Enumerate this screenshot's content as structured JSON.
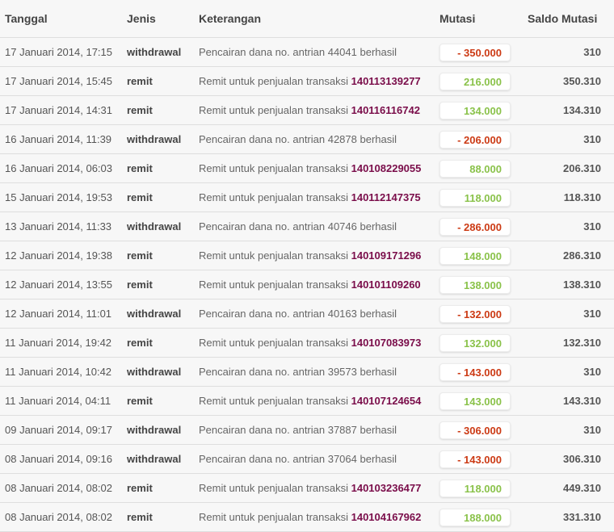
{
  "columns": {
    "date": "Tanggal",
    "type": "Jenis",
    "description": "Keterangan",
    "mutation": "Mutasi",
    "balance": "Saldo Mutasi"
  },
  "colors": {
    "negative": "#cc3a14",
    "positive": "#8ac24a",
    "transaction_id": "#7a0d4a"
  },
  "rows": [
    {
      "date": "17 Januari 2014, 17:15",
      "type": "withdrawal",
      "desc": "Pencairan dana no. antrian 44041 berhasil",
      "desc_id": "",
      "mutation": "- 350.000",
      "sign": "neg",
      "balance": "310"
    },
    {
      "date": "17 Januari 2014, 15:45",
      "type": "remit",
      "desc": "Remit untuk penjualan transaksi ",
      "desc_id": "140113139277",
      "mutation": "216.000",
      "sign": "pos",
      "balance": "350.310"
    },
    {
      "date": "17 Januari 2014, 14:31",
      "type": "remit",
      "desc": "Remit untuk penjualan transaksi ",
      "desc_id": "140116116742",
      "mutation": "134.000",
      "sign": "pos",
      "balance": "134.310"
    },
    {
      "date": "16 Januari 2014, 11:39",
      "type": "withdrawal",
      "desc": "Pencairan dana no. antrian 42878 berhasil",
      "desc_id": "",
      "mutation": "- 206.000",
      "sign": "neg",
      "balance": "310"
    },
    {
      "date": "16 Januari 2014, 06:03",
      "type": "remit",
      "desc": "Remit untuk penjualan transaksi ",
      "desc_id": "140108229055",
      "mutation": "88.000",
      "sign": "pos",
      "balance": "206.310"
    },
    {
      "date": "15 Januari 2014, 19:53",
      "type": "remit",
      "desc": "Remit untuk penjualan transaksi ",
      "desc_id": "140112147375",
      "mutation": "118.000",
      "sign": "pos",
      "balance": "118.310"
    },
    {
      "date": "13 Januari 2014, 11:33",
      "type": "withdrawal",
      "desc": "Pencairan dana no. antrian 40746 berhasil",
      "desc_id": "",
      "mutation": "- 286.000",
      "sign": "neg",
      "balance": "310"
    },
    {
      "date": "12 Januari 2014, 19:38",
      "type": "remit",
      "desc": "Remit untuk penjualan transaksi ",
      "desc_id": "140109171296",
      "mutation": "148.000",
      "sign": "pos",
      "balance": "286.310"
    },
    {
      "date": "12 Januari 2014, 13:55",
      "type": "remit",
      "desc": "Remit untuk penjualan transaksi ",
      "desc_id": "140101109260",
      "mutation": "138.000",
      "sign": "pos",
      "balance": "138.310"
    },
    {
      "date": "12 Januari 2014, 11:01",
      "type": "withdrawal",
      "desc": "Pencairan dana no. antrian 40163 berhasil",
      "desc_id": "",
      "mutation": "- 132.000",
      "sign": "neg",
      "balance": "310"
    },
    {
      "date": "11 Januari 2014, 19:42",
      "type": "remit",
      "desc": "Remit untuk penjualan transaksi ",
      "desc_id": "140107083973",
      "mutation": "132.000",
      "sign": "pos",
      "balance": "132.310"
    },
    {
      "date": "11 Januari 2014, 10:42",
      "type": "withdrawal",
      "desc": "Pencairan dana no. antrian 39573 berhasil",
      "desc_id": "",
      "mutation": "- 143.000",
      "sign": "neg",
      "balance": "310"
    },
    {
      "date": "11 Januari 2014, 04:11",
      "type": "remit",
      "desc": "Remit untuk penjualan transaksi ",
      "desc_id": "140107124654",
      "mutation": "143.000",
      "sign": "pos",
      "balance": "143.310"
    },
    {
      "date": "09 Januari 2014, 09:17",
      "type": "withdrawal",
      "desc": "Pencairan dana no. antrian 37887 berhasil",
      "desc_id": "",
      "mutation": "- 306.000",
      "sign": "neg",
      "balance": "310"
    },
    {
      "date": "08 Januari 2014, 09:16",
      "type": "withdrawal",
      "desc": "Pencairan dana no. antrian 37064 berhasil",
      "desc_id": "",
      "mutation": "- 143.000",
      "sign": "neg",
      "balance": "306.310"
    },
    {
      "date": "08 Januari 2014, 08:02",
      "type": "remit",
      "desc": "Remit untuk penjualan transaksi ",
      "desc_id": "140103236477",
      "mutation": "118.000",
      "sign": "pos",
      "balance": "449.310"
    },
    {
      "date": "08 Januari 2014, 08:02",
      "type": "remit",
      "desc": "Remit untuk penjualan transaksi ",
      "desc_id": "140104167962",
      "mutation": "188.000",
      "sign": "pos",
      "balance": "331.310"
    }
  ]
}
